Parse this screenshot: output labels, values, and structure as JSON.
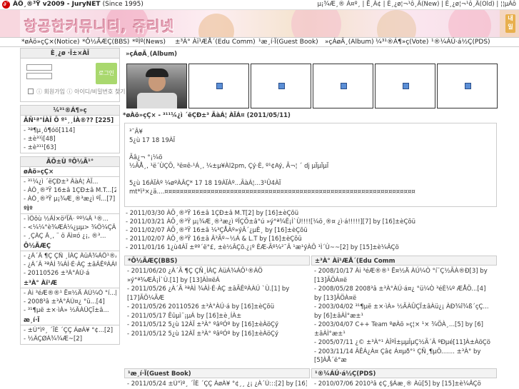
{
  "header": {
    "logo_char": "∂¯",
    "site_title": "ÀÕ¸®³Ÿ v2009 - JuryNET",
    "since": "(Since 1995)",
    "top_links": "µ¡¾Æ¸®  Á¤º¸ | Ë¸Á¢ | È¸¿ø¦¬¹ô¸Ã(New) | È¸¿ø¦¬¹ô¸Ã(Old) | ¦¦µÁô",
    "banner_text": "항공한커뮤니티, 쥬리넷",
    "ribbon": "내일"
  },
  "nav": {
    "items": [
      "*øÀö»çÇ×(Notice)",
      "*Ô½ÃÆÇ(BBS)",
      "*ºÌº(News)",
      "±³À° Àï¹ÆÅ´(Edu Comm)",
      "¹æ¸í·Ï(Guest Book)",
      "»çÁøÃ¸(Album)",
      "¼³¹®Á¶»ç(Vote)",
      "¹®¼ÁÚ·á½Ç(PDS)"
    ]
  },
  "sidebar": {
    "login_title": "È¸¿ø ·Î±×ÀÎ",
    "login_button": "로그인",
    "login_links": "ⓘ 회원가입 ⓘ 아이디/비밀번호 찾기",
    "poll_title": "¼³¹®Á¶»ç",
    "poll_question": "ÃÑ¹ª°ÍÀÎ Ö º¹¸¸ÍÀ®?? [225]",
    "poll_options": [
      "- ³ª¶µ¸ô¶óö[114]",
      "- ±è³¹ì[48]",
      "- ±è³¹¹[63]"
    ],
    "latest_title": "ÃÖ±Ù ºÔ½Ã¹°",
    "notice_label": "øÀö»çÇ×",
    "notice_items": [
      "- ³¹¼¿ì ´ëÇÐ±³ ÃàÁ¦ ÀÏ...",
      "- ÀÕ¸®³Ÿ 16±â 1ÇÐ±â M.T...[2]",
      "- ÀÕ¸®³Ÿ µ¡¾Æ¸®³æ¿ì ºÏ...[7]"
    ],
    "news_label": "ºÌº",
    "news_items": [
      "- ìÖôù ½ÃÌ×ö²ÏÃ· ºº¼Ã ¹®...",
      "- <¼¼°è¾ÆÀ¼¿µµ> ¾Ö¼ÇÃ°ú, @...",
      "- ¸ÇÀÇ Ã¸, ¨ ö Ãì¤ó ¿¡, ®³..."
    ],
    "bbs_label": "Ô½ÃÆÇ",
    "bbs_items": [
      "- ¿À´Ã ¶Ç ÇÑ ¸ÍÀÇ ÀüÁ¾ÁÖ¹®ÁÖ...",
      "- ¿À´Ã ³ªÀÌ ¾ÀÌ·É·ÀÇ ±âÃÊºÀÀÚ...[1]",
      "- 20110526 ±³À°ÀÚ·á"
    ],
    "edu_label": "±³À° Àï¹Æ",
    "edu_items": [
      "- Ài ³éÆ®®¹ Ë¤½Ä ÀÚ¼Ò °í...[3]",
      "- 2008³â ±³À°ÀÚ¤¿ °ü...[4]",
      "- ³¹¶µë ±×·ìÀ» ½ÃÀÛÇÏ±â..."
    ],
    "gb_label": "æ¸í·Ï",
    "gb_items": [
      "- ±Ù°ìº¸ ´ÏÈ ´ÇÇ ÁøÀ¥ °¢...[2]",
      "- ½ÃÇØÀ¾¾Æ~[2]"
    ]
  },
  "album": {
    "title": "»çÁøÃ¸(Album)"
  },
  "notice": {
    "head": "*øÀö»çÇ× - ³¹¹¼¿ì ´ëÇÐ±³ ÃàÁ¦ ÀÏÁ¤ (2011/05/11)",
    "lines": [
      "³¯Â¥",
      "   5¿ù 17 18 19ÀÏ",
      "",
      "Ãâ¿¬ °¡¼ö",
      "   ½ÃÅ¸, ¹ë´ÙÇÕ, ³ë¤ê-¹Á¸, ¼±µ¥Àl2pm, Çý·È, º¹¢Aý, Ã¬¦ ´ dj µÏµÏµÏ",
      "",
      "5¿ù 16ÀÏÀº ¼øºÀÂÇ* 17 18 19ÀÏÀº...ÃàÁ¦...3¹Û4ÀÏ",
      "mt*ì³×¿ä....¤¤¤¤¤¤¤¤¤¤¤¤¤¤¤¤¤¤¤¤¤¤¤¤¤¤¤¤¤¤¤¤¤¤¤¤¤¤¤¤¤¤¤¤¤¤¤¤¤¤¤¤¤¤¤¤¤¤¤¤¤¤¤¤¤"
    ],
    "posts": [
      "- 2011/03/30 ÀÕ¸®³Ÿ 16±â 1ÇÐ±â M.T[2] by [16]±èÇõü",
      "- 2011/03/21 ÀÕ¸®³Ÿ µ¡¾Æ¸®³æ¿ì ºÏÇÕ±â°ú »ý°ª¾Ê¡Ì`Ù!!!![¼ö¸®¤ ¿ì·á!!!!!][7] by [16]±èÇõü",
      "- 2011/02/07 ÀÕ¸®³Ÿ 16±â ¼³ÇÅÀº»ýÂ´¿µÈ¸ by [16]±èÇõü",
      "- 2011/02/07 ÀÕ¸®³Ÿ 16±â Â³Ãº~½Á & L.T by [16]±èÇõü",
      "- 2011/01/16 1¿ù4ÀÏ ±ºº´ë°£, ±è½ÂÇõ.¿¡º ÈÆ-Ãº¼²¯Â ¹æ¹ýÀÔ ¹Ì´Ù~~[2] by [15]±è¼ÂÇö"
    ]
  },
  "bbs": {
    "title": "*Ô½ÃÆÇ(BBS)",
    "items": [
      "- 2011/06/20 ¿À´Ã ¶Ç ÇÑ¸ÍÀÇ ÀüÁ¾ÁÖ¹®ÁÖ »ý°ª¾ÆÂ¡Ì`Ù.[1] by [13]ÀÌ¤ëÁ",
      "- 2011/05/26 ¿À´Ã ³ªÀÌ ¾ÀÌ·É·ÀÇ ±âÃÊºÀÀÚ `Ù.[1] by [17]ÃÖ¼ÃÆ",
      "- 2011/05/26 20110526 ±³À°ÀÚ·á by [16]±èÇõü",
      "- 2011/05/17 Êûµì¨¡µÁ by [16]±è¸ÍÀ±",
      "- 2011/05/12 5¿ù 12ÀÏ ±³À° ºâºÓº by [16]±èÀöÇý",
      "- 2011/05/12 5¿ù 12ÀÏ ±³À° ºâºÓº by [16]±èÀöÇý"
    ]
  },
  "edu": {
    "title": "±³À° Àï¹ÆÅ´(Edu Comm",
    "items": [
      "- 2008/10/17 Ài ³éÆ®®¹ Ë¤½Ä ÀÚ¼Ò °í¨Ç½ÃÀ®Ð[3] by [13]ÃÖÀ¤ë",
      "- 2008/05/28 2008³â ±³À°ÀÚ·á¤¿ °ü¼Ò ³éÈ¼º ÆÅÖ...[4] by [13]ÃÖÀ¤ë",
      "- 2003/04/02 ³¹¶µë ±×·ìÀ» ½ÃÀÛÇÏ±âÀü¿¡ ÀÐ¾î¾ß´çÇ... by [6]±âÀÌ°æ±¹",
      "- 2003/04/07 C++ Team ºøÀö »ç¦× ¹× ¾ÖÀ¸...[5] by [6]±âÀÌ°æ±¹",
      "- 2005/07/11 ¿© ±³À°¹ ÀÎºÎ±µµÎµÇ½Ã´Â ºÐµé[11]À±ÀöÇö",
      "- 2003/11/14 ÂÊÁ¿À¤ Çâ¢ Á¤µð°¹ ÇÑ¸¶µÖ....... ±³À° by [5]ÀÅ´ë°æ"
    ]
  },
  "guestbook": {
    "title": "¹æ¸í·Ï(Guest Book)",
    "items": [
      "- 2011/05/24 ±Ù°ìº¸ ´ÏÈ ´ÇÇ ÁøÀ¥ °¢¸¸ ¿¡ ¿À´Ù:::[2] by [16]±è"
    ]
  },
  "pds": {
    "title": "¹®¼ÁÚ·á½Ç(PDS)",
    "items": [
      "- 2010/07/06 2010³â ¢Ç¸§Áæ¸® Àü[5] by [15]±è¼ÂÇö"
    ]
  },
  "colors": {
    "login_button_bg": "#a9d86e",
    "logo_red": "#d10000",
    "placeholder_blue": "#5b8fd6"
  }
}
